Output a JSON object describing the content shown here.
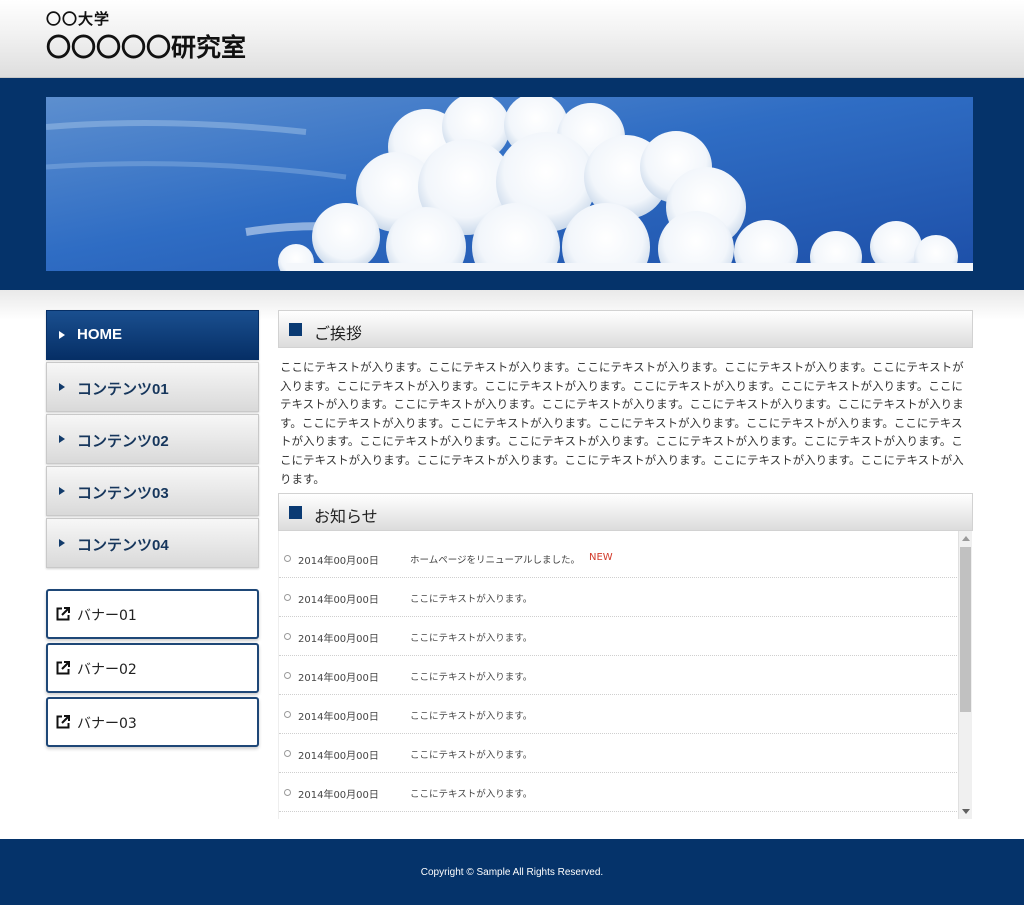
{
  "header": {
    "university": "〇〇大学",
    "lab": "〇〇〇〇〇研究室"
  },
  "hero": {
    "image": "sky-with-cumulus-clouds"
  },
  "nav": {
    "items": [
      {
        "label": "HOME",
        "active": true
      },
      {
        "label": "コンテンツ01",
        "active": false
      },
      {
        "label": "コンテンツ02",
        "active": false
      },
      {
        "label": "コンテンツ03",
        "active": false
      },
      {
        "label": "コンテンツ04",
        "active": false
      }
    ]
  },
  "banners": [
    {
      "label": "バナー01",
      "icon": "external-link-icon"
    },
    {
      "label": "バナー02",
      "icon": "external-link-icon"
    },
    {
      "label": "バナー03",
      "icon": "external-link-icon"
    }
  ],
  "greeting": {
    "title": "ご挨拶",
    "body": "ここにテキストが入ります。ここにテキストが入ります。ここにテキストが入ります。ここにテキストが入ります。ここにテキストが入ります。ここにテキストが入ります。ここにテキストが入ります。ここにテキストが入ります。ここにテキストが入ります。ここにテキストが入ります。ここにテキストが入ります。ここにテキストが入ります。ここにテキストが入ります。ここにテキストが入ります。ここにテキストが入ります。ここにテキストが入ります。ここにテキストが入ります。ここにテキストが入ります。ここにテキストが入ります。ここにテキストが入ります。ここにテキストが入ります。ここにテキストが入ります。ここにテキストが入ります。ここにテキストが入ります。ここにテキストが入ります。ここにテキストが入ります。ここにテキストが入ります。ここにテキストが入ります。"
  },
  "news": {
    "title": "お知らせ",
    "items": [
      {
        "date": "2014年00月00日",
        "text": "ホームページをリニューアルしました。",
        "badge": "NEW"
      },
      {
        "date": "2014年00月00日",
        "text": "ここにテキストが入ります。",
        "badge": ""
      },
      {
        "date": "2014年00月00日",
        "text": "ここにテキストが入ります。",
        "badge": ""
      },
      {
        "date": "2014年00月00日",
        "text": "ここにテキストが入ります。",
        "badge": ""
      },
      {
        "date": "2014年00月00日",
        "text": "ここにテキストが入ります。",
        "badge": ""
      },
      {
        "date": "2014年00月00日",
        "text": "ここにテキストが入ります。",
        "badge": ""
      },
      {
        "date": "2014年00月00日",
        "text": "ここにテキストが入ります。",
        "badge": ""
      }
    ]
  },
  "footer": {
    "copyright": "Copyright © Sample All Rights Reserved."
  },
  "colors": {
    "navy": "#05336a",
    "new_badge": "#d23a2a"
  }
}
